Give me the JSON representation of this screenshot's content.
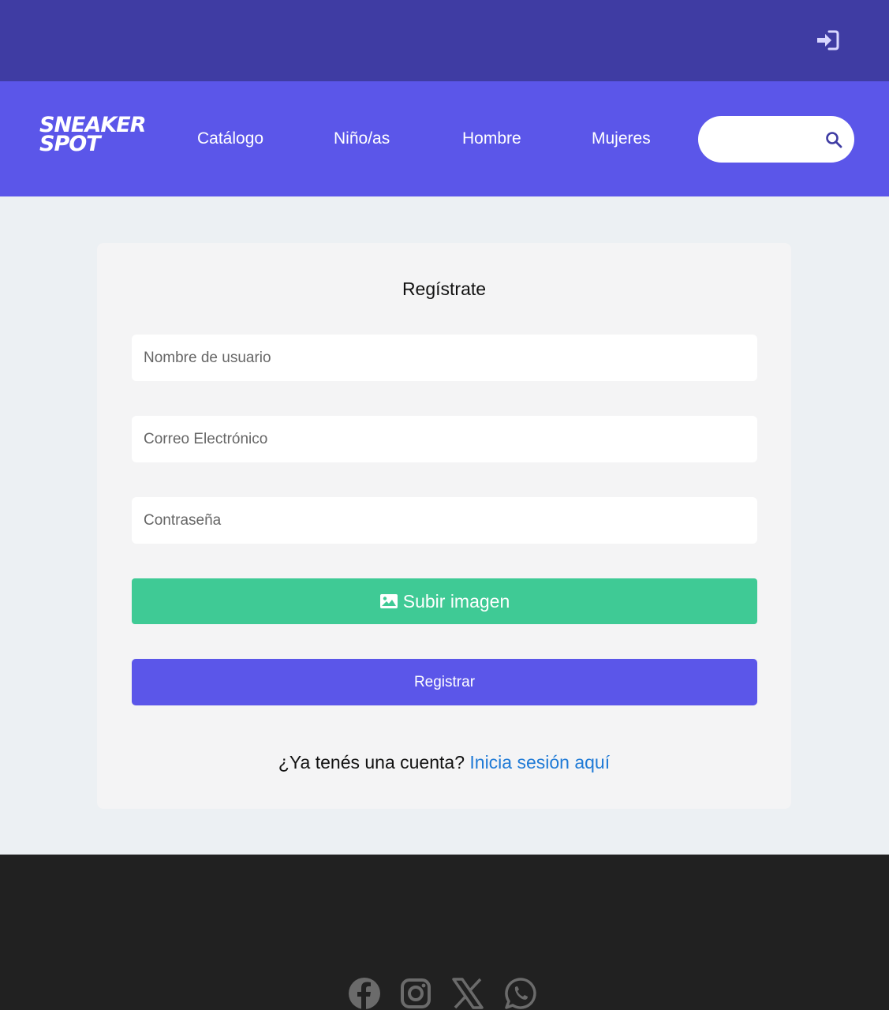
{
  "header": {
    "login_icon": "sign-in-icon"
  },
  "nav": {
    "logo_line1": "SNEAKER",
    "logo_line2": "SPOT",
    "links": [
      "Catálogo",
      "Niño/as",
      "Hombre",
      "Mujeres"
    ],
    "search_placeholder": "",
    "search_icon": "search-icon"
  },
  "form": {
    "title": "Regístrate",
    "username_placeholder": "Nombre de usuario",
    "email_placeholder": "Correo Electrónico",
    "password_placeholder": "Contraseña",
    "upload_label": "Subir imagen",
    "upload_icon": "image-icon",
    "register_label": "Registrar",
    "login_prompt": "¿Ya tenés una cuenta?",
    "login_link": "Inicia sesión aquí"
  },
  "footer": {
    "social_icons": [
      "facebook-icon",
      "instagram-icon",
      "x-icon",
      "whatsapp-icon"
    ]
  },
  "colors": {
    "topbar": "#3f3ca3",
    "navbar": "#5b56e9",
    "upload_button": "#3fca95",
    "register_button": "#5b56e9",
    "link": "#1f7ad6",
    "footer": "#212121"
  }
}
